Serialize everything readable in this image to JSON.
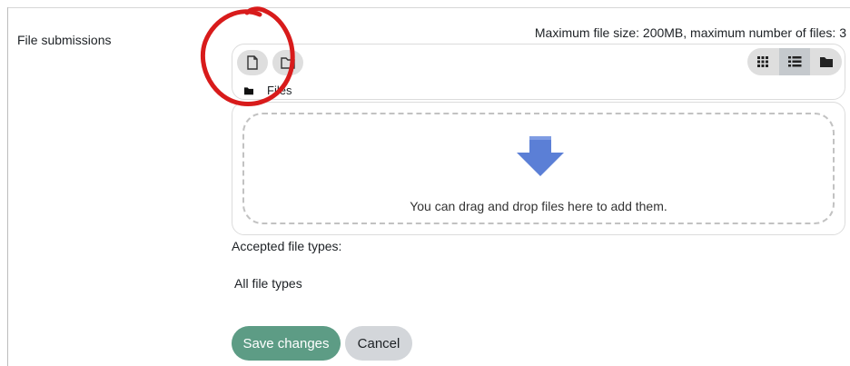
{
  "field": {
    "label": "File submissions"
  },
  "limits": {
    "text": "Maximum file size: 200MB, maximum number of files: 3"
  },
  "toolbar": {
    "add_icon": "file-icon",
    "folder_icon": "folder-icon",
    "views": [
      "grid-view-icon",
      "list-view-icon",
      "tree-view-icon"
    ],
    "active_view": "list-view-icon"
  },
  "path": {
    "label": "Files"
  },
  "dropzone": {
    "text": "You can drag and drop files here to add them."
  },
  "accepted": {
    "label": "Accepted file types:",
    "value": "All file types"
  },
  "actions": {
    "save": "Save changes",
    "cancel": "Cancel"
  },
  "colors": {
    "save_button": "#5d9c85",
    "annotation": "#d81b1b",
    "arrow": "#5b7fd6"
  }
}
